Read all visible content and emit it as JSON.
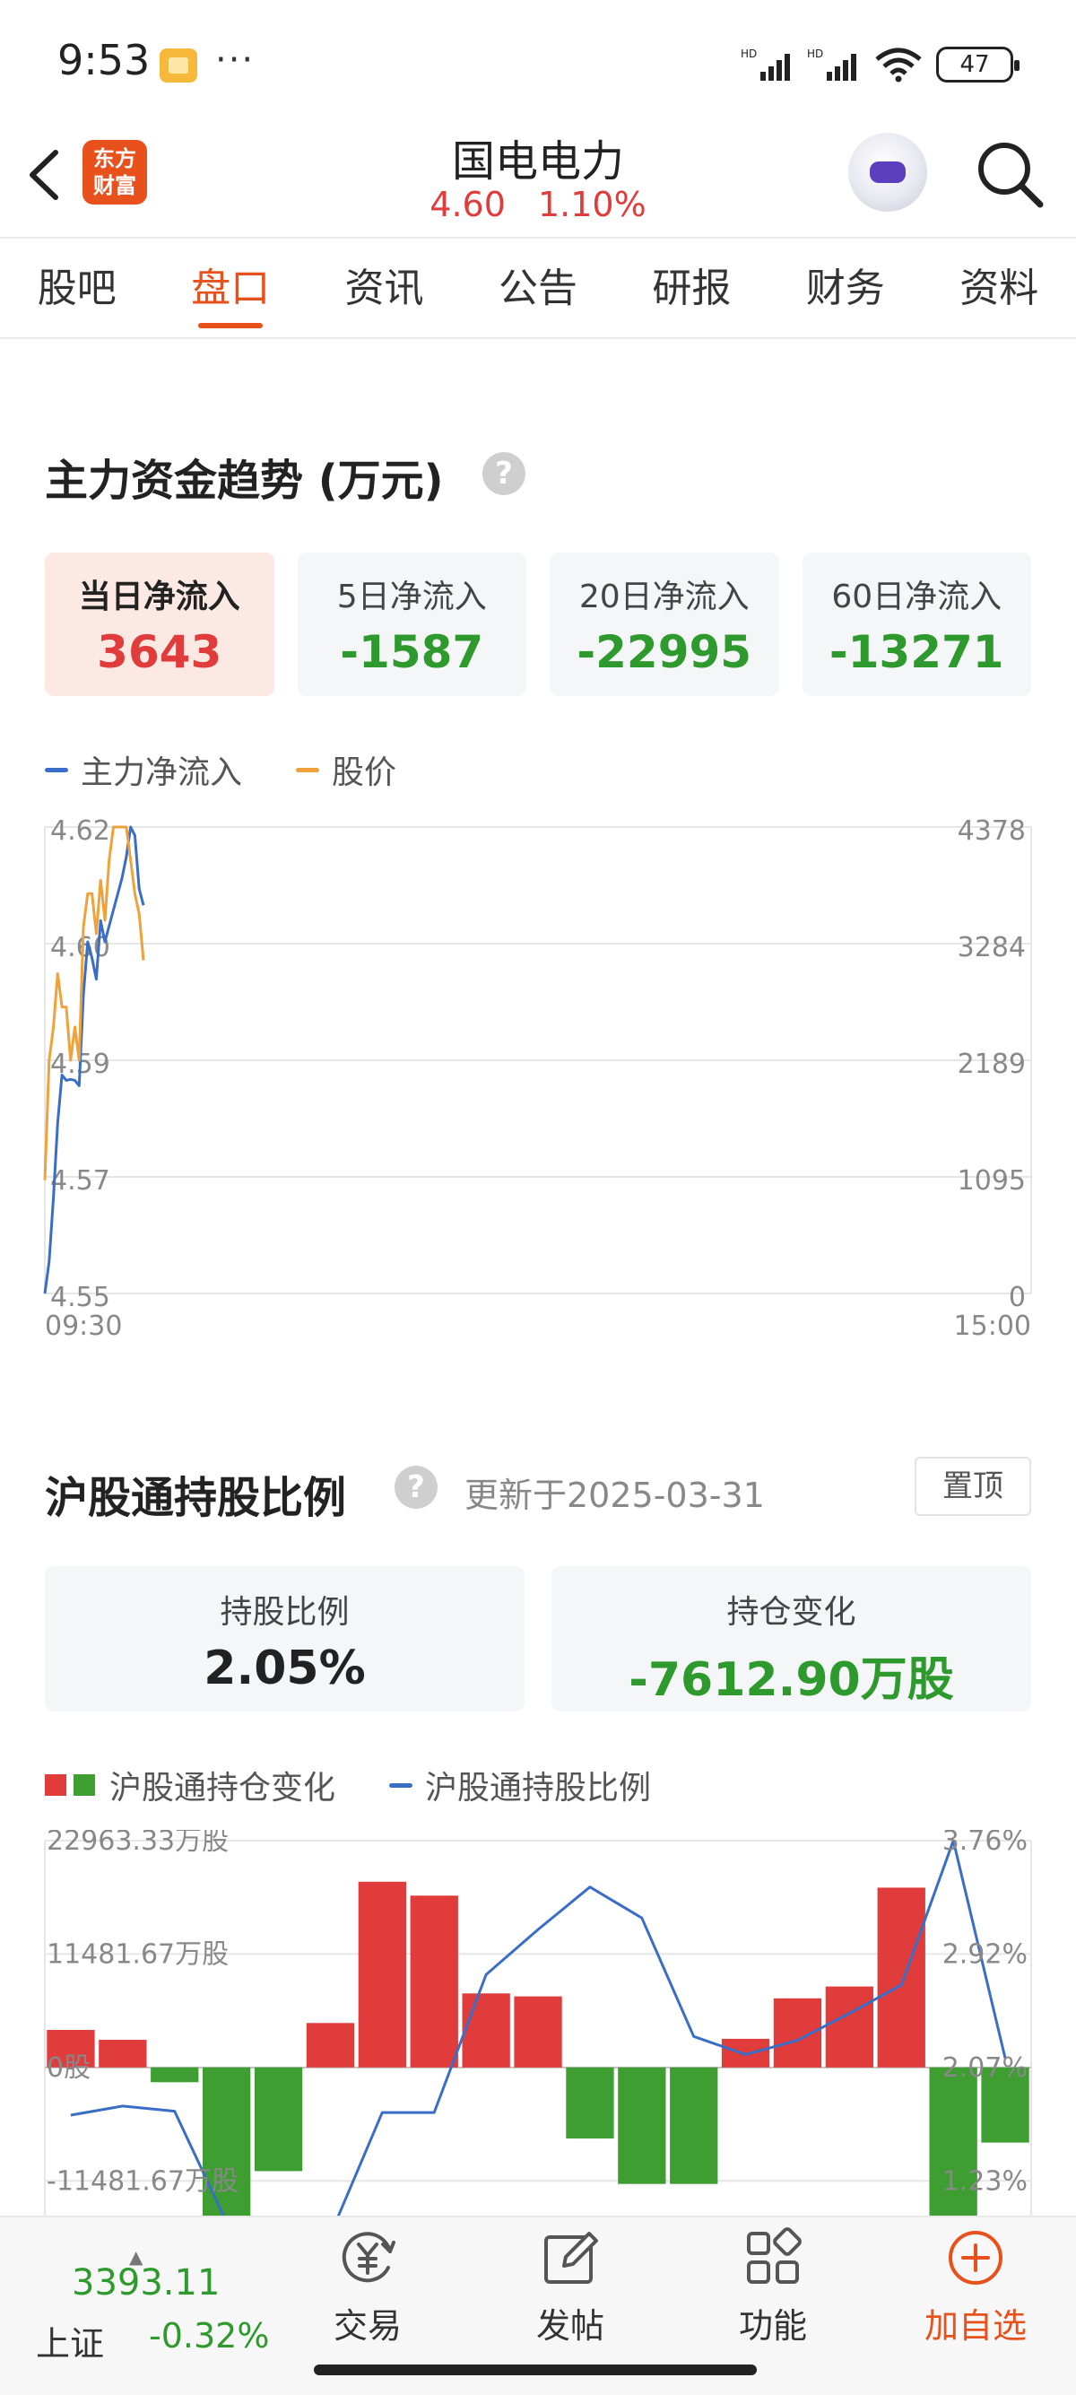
{
  "status_bar": {
    "time": "9:53",
    "dots": "···",
    "battery": "47",
    "signal_tag": "HD"
  },
  "header": {
    "brand_text": "东方\n财富",
    "brand_line1": "东方",
    "brand_line2": "财富",
    "stock_name": "国电电力",
    "price": "4.60",
    "change_pct": "1.10%"
  },
  "tabs": [
    {
      "label": "股吧",
      "active": false
    },
    {
      "label": "盘口",
      "active": true
    },
    {
      "label": "资讯",
      "active": false
    },
    {
      "label": "公告",
      "active": false
    },
    {
      "label": "研报",
      "active": false
    },
    {
      "label": "财务",
      "active": false
    },
    {
      "label": "资料",
      "active": false
    }
  ],
  "capital_flow": {
    "title": "主力资金趋势 (万元)",
    "help": "?",
    "cards": [
      {
        "label": "当日净流入",
        "value": "3643",
        "tone": "red",
        "active": true
      },
      {
        "label": "5日净流入",
        "value": "-1587",
        "tone": "green",
        "active": false
      },
      {
        "label": "20日净流入",
        "value": "-22995",
        "tone": "green",
        "active": false
      },
      {
        "label": "60日净流入",
        "value": "-13271",
        "tone": "green",
        "active": false
      }
    ],
    "legend": {
      "net_inflow": "主力净流入",
      "price": "股价"
    },
    "colors": {
      "net_inflow": "#3a6ec6",
      "price": "#f0a23a"
    }
  },
  "hk_connect": {
    "title": "沪股通持股比例",
    "help": "?",
    "updated": "更新于2025-03-31",
    "pin_label": "置顶",
    "cards": [
      {
        "label": "持股比例",
        "value": "2.05%",
        "tone": "dark"
      },
      {
        "label": "持仓变化",
        "value": "-7612.90万股",
        "tone": "green"
      }
    ],
    "legend": {
      "holding_change": "沪股通持仓变化",
      "holding_ratio": "沪股通持股比例"
    },
    "colors": {
      "up": "#e03c3c",
      "down": "#3e9e32",
      "ratio": "#3a6ec6"
    }
  },
  "chart_data": [
    {
      "type": "line",
      "title": "",
      "x_ticks": [
        "09:30",
        "15:00"
      ],
      "y_left_ticks": [
        "4.62",
        "4.60",
        "4.59",
        "4.57",
        "4.55"
      ],
      "y_right_ticks": [
        "4378",
        "3284",
        "2189",
        "1095",
        "0"
      ],
      "ylim_left": [
        4.55,
        4.62
      ],
      "ylim_right": [
        0,
        4378
      ],
      "series": [
        {
          "name": "主力净流入",
          "axis": "right",
          "values": [
            0,
            300,
            900,
            1600,
            2050,
            2000,
            2010,
            2000,
            1950,
            2800,
            3300,
            3150,
            2950,
            3500,
            3300,
            3450,
            3600,
            3750,
            3900,
            4100,
            4378,
            4300,
            3800,
            3643
          ]
        },
        {
          "name": "股价",
          "axis": "left",
          "values": [
            4.567,
            4.585,
            4.59,
            4.598,
            4.593,
            4.593,
            4.585,
            4.59,
            4.585,
            4.605,
            4.61,
            4.61,
            4.604,
            4.612,
            4.606,
            4.615,
            4.62,
            4.62,
            4.62,
            4.62,
            4.615,
            4.61,
            4.607,
            4.6
          ]
        }
      ],
      "grid": true
    },
    {
      "type": "bar",
      "title": "",
      "y_left_ticks": [
        "22963.33万股",
        "11481.67万股",
        "0股",
        "-11481.67万股"
      ],
      "y_right_ticks": [
        "3.76%",
        "2.92%",
        "2.07%",
        "1.23%"
      ],
      "ylim_left": [
        -15000,
        22963.33
      ],
      "ylim_right": [
        0.85,
        3.76
      ],
      "series": [
        {
          "name": "沪股通持仓变化",
          "values": [
            3800,
            2800,
            -1500,
            -15000,
            -10500,
            4500,
            18800,
            17400,
            7500,
            7200,
            -7200,
            -11800,
            -11800,
            2900,
            7000,
            8200,
            18200,
            -15000,
            -7612.9
          ]
        },
        {
          "name": "沪股通持股比例",
          "values": [
            1.63,
            1.7,
            1.66,
            0.8,
            0.4,
            0.7,
            1.65,
            1.65,
            2.72,
            3.07,
            3.4,
            3.16,
            2.24,
            2.1,
            2.21,
            2.42,
            2.64,
            3.76,
            2.07
          ]
        }
      ],
      "grid": true
    }
  ],
  "bottom_nav": {
    "index_value": "3393.11",
    "index_name": "上证",
    "index_change": "-0.32%",
    "items": [
      {
        "label": "交易",
        "icon": "trade-yen-icon"
      },
      {
        "label": "发帖",
        "icon": "post-edit-icon"
      },
      {
        "label": "功能",
        "icon": "grid-apps-icon"
      },
      {
        "label": "加自选",
        "icon": "add-circle-icon"
      }
    ]
  }
}
